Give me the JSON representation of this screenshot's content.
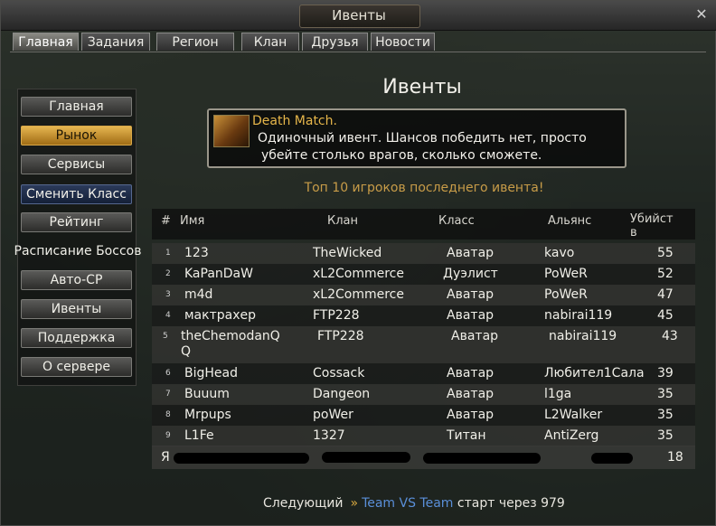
{
  "window": {
    "title": "Ивенты"
  },
  "tabs": [
    {
      "label": "Главная",
      "active": true
    },
    {
      "label": "Задания"
    },
    {
      "label": "Регион"
    },
    {
      "label": "Клан"
    },
    {
      "label": "Друзья"
    },
    {
      "label": "Новости"
    }
  ],
  "sidebar": {
    "items": [
      {
        "label": "Главная"
      },
      {
        "label": "Рынок",
        "style": "gold"
      },
      {
        "label": "Сервисы"
      },
      {
        "label": "Сменить Класс",
        "style": "blue"
      },
      {
        "label": "Рейтинг"
      },
      {
        "label": "Расписание Боссов",
        "style": "plain"
      },
      {
        "label": "Авто-СР"
      },
      {
        "label": "Ивенты"
      },
      {
        "label": "Поддержка"
      },
      {
        "label": "О сервере"
      }
    ]
  },
  "main": {
    "title": "Ивенты",
    "event": {
      "name": "Death Match.",
      "line1": "Одиночный ивент. Шансов победить нет, просто",
      "line2": "убейте столько врагов, сколько сможете."
    },
    "caption": "Топ 10 игроков последнего ивента!"
  },
  "table": {
    "headers": {
      "num": "#",
      "name": "Имя",
      "clan": "Клан",
      "class": "Класс",
      "alliance": "Альянс",
      "kills1": "Убийст",
      "kills2": "в"
    },
    "rows": [
      {
        "n": "1",
        "name": "123",
        "clan": "TheWicked",
        "class": "Аватар",
        "alliance": "kavo",
        "kills": "55"
      },
      {
        "n": "2",
        "name": "KaPanDaW",
        "clan": "xL2Commerce",
        "class": "Дуэлист",
        "alliance": "PoWeR",
        "kills": "52"
      },
      {
        "n": "3",
        "name": "m4d",
        "clan": "xL2Commerce",
        "class": "Аватар",
        "alliance": "PoWeR",
        "kills": "47"
      },
      {
        "n": "4",
        "name": "мактрахер",
        "clan": "FTP228",
        "class": "Аватар",
        "alliance": "nabirai119",
        "kills": "45"
      },
      {
        "n": "5",
        "name": "theChemodanQ",
        "name2": "Q",
        "clan": "FTP228",
        "class": "Аватар",
        "alliance": "nabirai119",
        "kills": "43"
      },
      {
        "n": "6",
        "name": "BigHead",
        "clan": "Cossack",
        "class": "Аватар",
        "alliance": "Любител1Сала",
        "kills": "39"
      },
      {
        "n": "7",
        "name": "Buuum",
        "clan": "Dangeon",
        "class": "Аватар",
        "alliance": "l1ga",
        "kills": "35"
      },
      {
        "n": "8",
        "name": "Mrpups",
        "clan": "poWer",
        "class": "Аватар",
        "alliance": "L2Walker",
        "kills": "35"
      },
      {
        "n": "9",
        "name": "L1Fe",
        "clan": "1327",
        "class": "Титан",
        "alliance": "AntiZerg",
        "kills": "35"
      }
    ],
    "my_row": {
      "n": "Я",
      "kills": "18"
    }
  },
  "footer": {
    "prefix": "Следующий",
    "arrow": "»",
    "event": "Team VS Team",
    "suffix": "старт через 979"
  },
  "colors": {
    "accent_gold": "#e6b64a",
    "link_blue": "#5a8fd8"
  }
}
